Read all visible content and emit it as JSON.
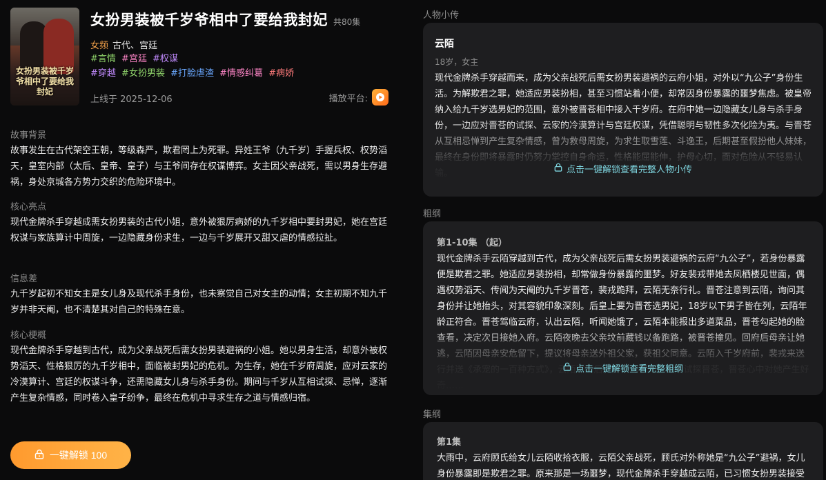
{
  "drama": {
    "title": "女扮男装被千岁爷相中了要给我封妃",
    "episodes": "共80集",
    "category_label": "女频",
    "category_value": "古代、宫廷",
    "tags_line1": [
      "#言情",
      "#宫廷",
      "#权谋"
    ],
    "tags_line2": [
      "#穿越",
      "#女扮男装",
      "#打脸虐渣",
      "#情感纠葛",
      "#病娇"
    ],
    "release": "上线于 2025-12-06",
    "platform_label": "播放平台:",
    "poster_text": "女扮男装被千岁爷相中了要给我封妃"
  },
  "sections": {
    "background": {
      "label": "故事背景",
      "text": "故事发生在古代架空王朝，等级森严，欺君罔上为死罪。异姓王爷（九千岁）手握兵权、权势滔天，皇室内部（太后、皇帝、皇子）与王爷间存在权谋博弈。女主因父亲战死，需以男身生存避祸，身处京城各方势力交织的危险环境中。"
    },
    "highlights": {
      "label": "核心亮点",
      "text": "现代金牌杀手穿越成需女扮男装的古代小姐，意外被狠厉病娇的九千岁相中要封男妃，她在宫廷权谋与家族算计中周旋，一边隐藏身份求生，一边与千岁展开又甜又虐的情感拉扯。"
    },
    "info_gap": {
      "label": "信息差",
      "text": "九千岁起初不知女主是女儿身及现代杀手身份，也未察觉自己对女主的动情；女主初期不知九千岁并非天阉，也不清楚其对自己的特殊在意。"
    },
    "core_plot": {
      "label": "核心梗概",
      "text": "现代金牌杀手穿越到古代，成为父亲战死后需女扮男装避祸的小姐。她以男身生活，却意外被权势滔天、性格狠厉的九千岁相中，面临被封男妃的危机。为生存，她在千岁府周旋，应对云家的冷漠算计、宫廷的权谋斗争，还需隐藏女儿身与杀手身份。期间与千岁从互相试探、忌惮，逐渐产生复杂情感，同时卷入皇子纷争，最终在危机中寻求生存之道与情感归宿。"
    }
  },
  "unlock_button": {
    "label": "一键解锁 100",
    "icon": "lock-icon"
  },
  "character": {
    "section_label": "人物小传",
    "name": "云陌",
    "sub": "18岁，女主",
    "text": "现代金牌杀手穿越而来，成为父亲战死后需女扮男装避祸的云府小姐，对外以“九公子”身份生活。为解欺君之罪，她适应男装扮相，甚至习惯站着小便，却常因身份暴露的噩梦焦虑。被皇帝纳入给九千岁选男妃的范围，意外被晋苍相中接入千岁府。在府中她一边隐藏女儿身与杀手身份，一边应对晋苍的试探、云家的冷漠算计与宫廷权谋，凭借聪明与韧性多次化险为夷。与晋苍从互相忌惮到产生复杂情感，曾为救母周旋，为求生取雪莲、斗逸王，后期甚至假扮他人妹妹，最终在身份即将暴露时仍努力掌控自身命运，性格能屈能伸，护母心切，面对危险从不轻易认输。",
    "unlock_text": "点击一键解锁查看完整人物小传"
  },
  "outline": {
    "section_label": "粗纲",
    "ep_head": "第1-10集 （起）",
    "text": "现代金牌杀手云陌穿越到古代，成为父亲战死后需女扮男装避祸的云府“九公子”，若身份暴露便是欺君之罪。她适应男装扮相，却常做身份暴露的噩梦。好友裴戎带她去凤栖楼见世面，偶遇权势滔天、传闻为天阉的九千岁晋苍，裴戎跪拜，云陌无奈行礼。晋苍注意到云陌，询问其身份并让她抬头，对其容貌印象深刻。后皇上要为晋苍选男妃，18岁以下男子皆在列，云陌年龄正符合。晋苍驾临云府，认出云陌，听闻她饿了，云陌本能报出多道菜品，晋苍勾起她的脸查看，决定次日接她入府。云陌夜晚去父亲坟前藏钱以备跑路，被晋苍撞见。回府后母亲让她逃，云陌因母亲安危留下，提议将母亲送外祖父家，获祖父同意。云陌入千岁府前，裴戎来送行并送《承宠的一百种方式》，云陌进府后，晋苍习惯她，云陌试探晋苍，晋苍心中对她产生好奇……",
    "unlock_text": "点击一键解锁查看完整粗纲"
  },
  "episode_outline": {
    "section_label": "集纲",
    "ep_head": "第1集",
    "text": "大雨中，云府顾氏给女儿云陌收拾衣服，云陌父亲战死，顾氏对外称她是“九公子”避祸，女儿身份暴露即是欺君之罪。原来那是一场噩梦，现代金牌杀手穿越成云陌，已习惯女扮男装接受世界观重塑……"
  }
}
